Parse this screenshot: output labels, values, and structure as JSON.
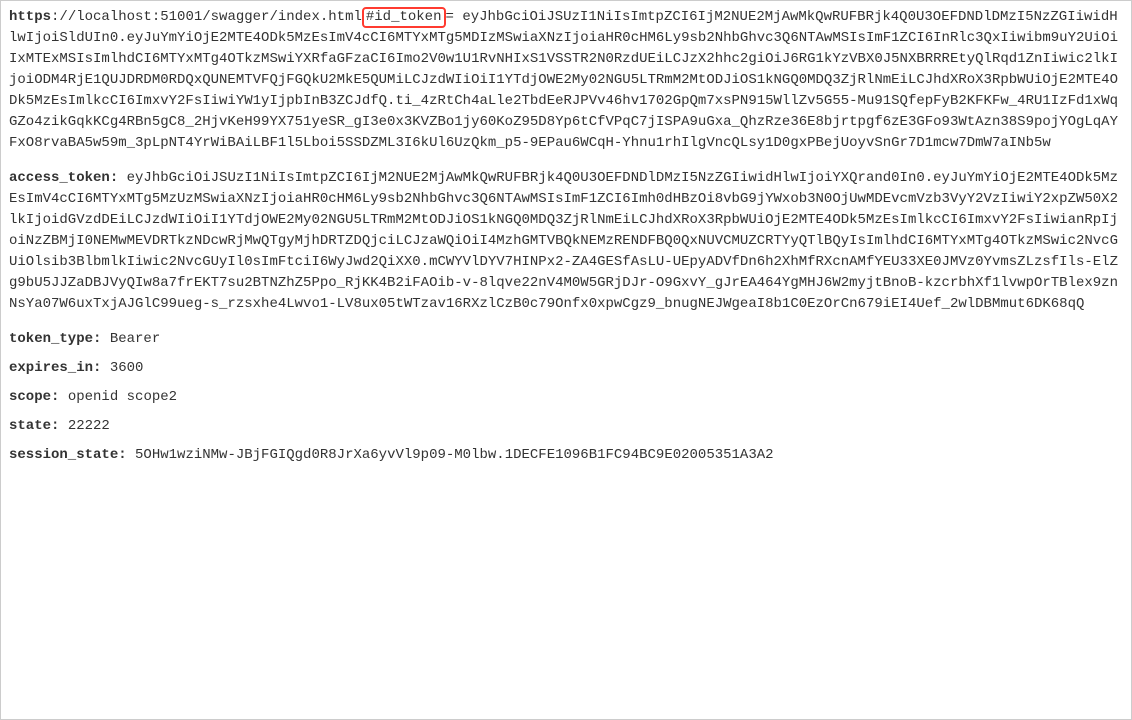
{
  "url": {
    "scheme": "https",
    "rest": "://localhost:51001/swagger/index.html",
    "highlight": "#id_token",
    "trailing": "="
  },
  "id_token_value": "eyJhbGciOiJSUzI1NiIsImtpZCI6IjM2NUE2MjAwMkQwRUFBRjk4Q0U3OEFDNDlDMzI5NzZGIiwidHlwIjoiSldUIn0.eyJuYmYiOjE2MTE4ODk5MzEsImV4cCI6MTYxMTg5MDIzMSwiaXNzIjoiaHR0cHM6Ly9sb2NhbGhvc3Q6NTAwMSIsImF1ZCI6InRlc3QxIiwibm9uY2UiOiIxMTExMSIsImlhdCI6MTYxMTg4OTkzMSwiYXRfaGFzaCI6Imo2V0w1U1RvNHIxS1VSSTR2N0RzdUEiLCJzX2hhc2giOiJ6RG1kYzVBX0J5NXBRRREtyQlRqd1ZnIiwic2lkIjoiODM4RjE1QUJDRDM0RDQxQUNEMTVFQjFGQkU2MkE5QUMiLCJzdWIiOiI1YTdjOWE2My02NGU5LTRmM2MtODJiOS1kNGQ0MDQ3ZjRlNmEiLCJhdXRoX3RpbWUiOjE2MTE4ODk5MzEsImlkcCI6ImxvY2FsIiwiYW1yIjpbInB3ZCJdfQ.ti_4zRtCh4aLle2TbdEeRJPVv46hv1702GpQm7xsPN915WllZv5G55-Mu91SQfepFyB2KFKFw_4RU1IzFd1xWqGZo4zikGqkKCg4RBn5gC8_2HjvKeH99YX751yeSR_gI3e0x3KVZBo1jy60KoZ95D8Yp6tCfVPqC7jISPA9uGxa_QhzRze36E8bjrtpgf6zE3GFo93WtAzn38S9pojYOgLqAYFxO8rvaBA5w59m_3pLpNT4YrWiBAiLBF1l5Lboi5SSDZML3I6kUl6UzQkm_p5-9EPau6WCqH-Yhnu1rhIlgVncQLsy1D0gxPBejUoyvSnGr7D1mcw7DmW7aINb5w",
  "access_token": {
    "label": "access_token:",
    "value": "eyJhbGciOiJSUzI1NiIsImtpZCI6IjM2NUE2MjAwMkQwRUFBRjk4Q0U3OEFDNDlDMzI5NzZGIiwidHlwIjoiYXQrand0In0.eyJuYmYiOjE2MTE4ODk5MzEsImV4cCI6MTYxMTg5MzUzMSwiaXNzIjoiaHR0cHM6Ly9sb2NhbGhvc3Q6NTAwMSIsImF1ZCI6Imh0dHBzOi8vbG9jYWxob3N0OjUwMDEvcmVzb3VyY2VzIiwiY2xpZW50X2lkIjoidGVzdDEiLCJzdWIiOiI1YTdjOWE2My02NGU5LTRmM2MtODJiOS1kNGQ0MDQ3ZjRlNmEiLCJhdXRoX3RpbWUiOjE2MTE4ODk5MzEsImlkcCI6ImxvY2FsIiwianRpIjoiNzZBMjI0NEMwMEVDRTkzNDcwRjMwQTgyMjhDRTZDQjciLCJzaWQiOiI4MzhGMTVBQkNEMzRENDFBQ0QxNUVCMUZCRTYyQTlBQyIsImlhdCI6MTYxMTg4OTkzMSwic2NvcGUiOlsib3BlbmlkIiwic2NvcGUyIl0sImFtciI6WyJwd2QiXX0.mCWYVlDYV7HINPx2-ZA4GESfAsLU-UEpyADVfDn6h2XhMfRXcnAMfYEU33XE0JMVz0YvmsZLzsfIls-ElZg9bU5JJZaDBJVyQIw8a7frEKT7su2BTNZhZ5Ppo_RjKK4B2iFAOib-v-8lqve22nV4M0W5GRjDJr-O9GxvY_gJrEA464YgMHJ6W2myjtBnoB-kzcrbhXf1lvwpOrTBlex9znNsYa07W6uxTxjAJGlC99ueg-s_rzsxhe4Lwvo1-LV8ux05tWTzav16RXzlCzB0c79Onfx0xpwCgz9_bnugNEJWgeaI8b1C0EzOrCn679iEI4Uef_2wlDBMmut6DK68qQ"
  },
  "token_type": {
    "label": "token_type:",
    "value": "Bearer"
  },
  "expires_in": {
    "label": "expires_in:",
    "value": "3600"
  },
  "scope": {
    "label": "scope:",
    "value": "openid scope2"
  },
  "state": {
    "label": "state:",
    "value": "22222"
  },
  "session_state": {
    "label": "session_state:",
    "value": "5OHw1wziNMw-JBjFGIQgd0R8JrXa6yvVl9p09-M0lbw.1DECFE1096B1FC94BC9E02005351A3A2"
  }
}
